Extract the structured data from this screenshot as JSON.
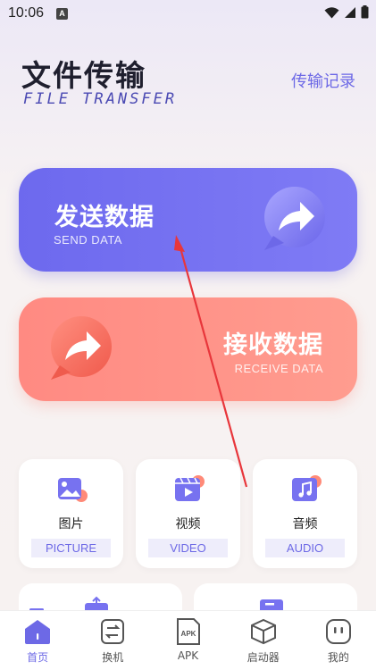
{
  "status": {
    "time": "10:06",
    "notification": "A"
  },
  "header": {
    "title_cn": "文件传输",
    "title_en": "FILE TRANSFER",
    "history_link": "传输记录"
  },
  "actions": {
    "send": {
      "title": "发送数据",
      "subtitle": "SEND DATA"
    },
    "receive": {
      "title": "接收数据",
      "subtitle": "RECEIVE DATA"
    }
  },
  "categories": [
    {
      "label": "图片",
      "label_en": "PICTURE"
    },
    {
      "label": "视频",
      "label_en": "VIDEO"
    },
    {
      "label": "音频",
      "label_en": "AUDIO"
    }
  ],
  "nav": {
    "items": [
      {
        "label": "首页",
        "active": true
      },
      {
        "label": "换机"
      },
      {
        "label": "APK",
        "icon_text": "APK"
      },
      {
        "label": "启动器"
      },
      {
        "label": "我的"
      }
    ]
  },
  "colors": {
    "accent": "#6d69e6",
    "send_card": "#7672f2",
    "receive_card": "#ff9186",
    "annotation_arrow": "#e8363b"
  }
}
